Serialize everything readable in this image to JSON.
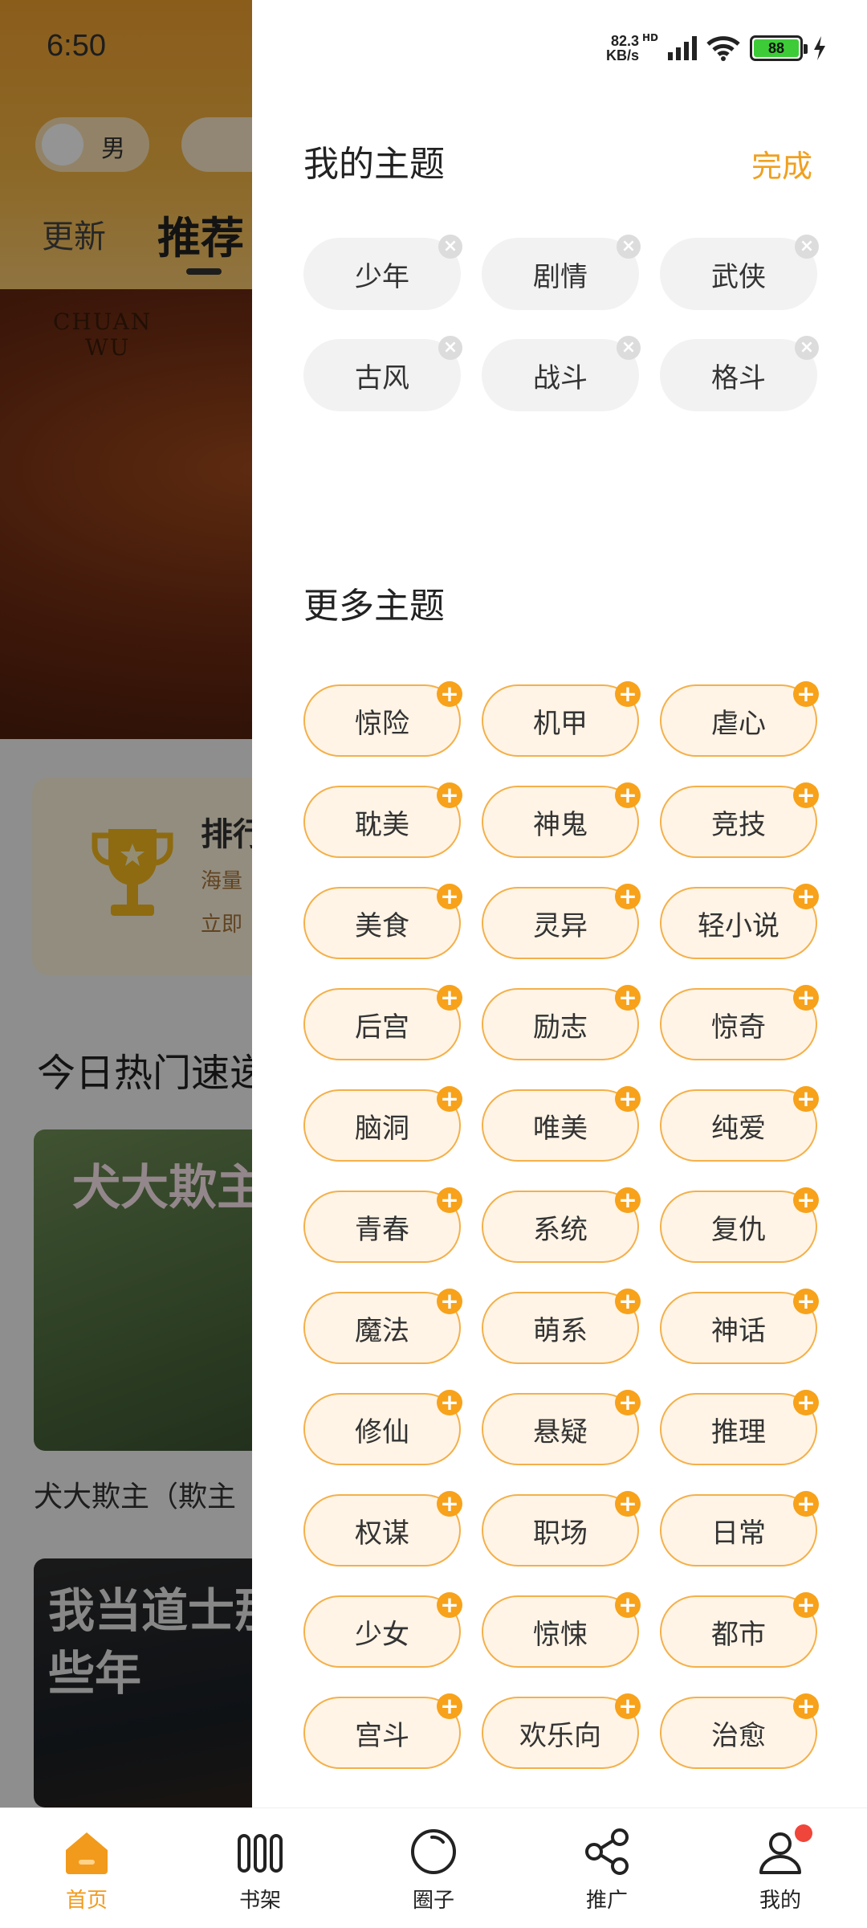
{
  "status_bar": {
    "time": "6:50",
    "net_speed_value": "82.3",
    "net_speed_unit": "KB/s",
    "network_type": "HD",
    "battery": "88"
  },
  "background": {
    "gender_toggle": "男",
    "tabs": [
      "更新",
      "推荐"
    ],
    "banner_logo_line1": "CHUAN",
    "banner_logo_line2": "WU",
    "rank_title": "排行",
    "rank_sub1": "海量",
    "rank_sub2": "立即",
    "hot_title": "今日热门速递",
    "cover1_title": "犬大欺主",
    "cover1_caption": "犬大欺主（欺主",
    "cover2_title": "我当道士那些年"
  },
  "drawer": {
    "my_topics_title": "我的主题",
    "done_label": "完成",
    "my_topics": [
      "少年",
      "剧情",
      "武侠",
      "古风",
      "战斗",
      "格斗"
    ],
    "more_topics_title": "更多主题",
    "more_topics": [
      "惊险",
      "机甲",
      "虐心",
      "耽美",
      "神鬼",
      "竞技",
      "美食",
      "灵异",
      "轻小说",
      "后宫",
      "励志",
      "惊奇",
      "脑洞",
      "唯美",
      "纯爱",
      "青春",
      "系统",
      "复仇",
      "魔法",
      "萌系",
      "神话",
      "修仙",
      "悬疑",
      "推理",
      "权谋",
      "职场",
      "日常",
      "少女",
      "惊悚",
      "都市",
      "宫斗",
      "欢乐向",
      "治愈"
    ],
    "remove_glyph": "×",
    "add_glyph": "+"
  },
  "bottom_nav": {
    "items": [
      {
        "label": "首页",
        "icon": "home-icon"
      },
      {
        "label": "书架",
        "icon": "bookshelf-icon"
      },
      {
        "label": "圈子",
        "icon": "circle-icon"
      },
      {
        "label": "推广",
        "icon": "share-icon"
      },
      {
        "label": "我的",
        "icon": "user-icon"
      }
    ]
  },
  "colors": {
    "accent": "#f0a020",
    "tag_more_bg": "#fff4e6",
    "tag_more_border": "#f4b04a",
    "tag_mine_bg": "#f2f2f2",
    "add_badge": "#f7a21a",
    "notification_dot": "#f0453a"
  }
}
